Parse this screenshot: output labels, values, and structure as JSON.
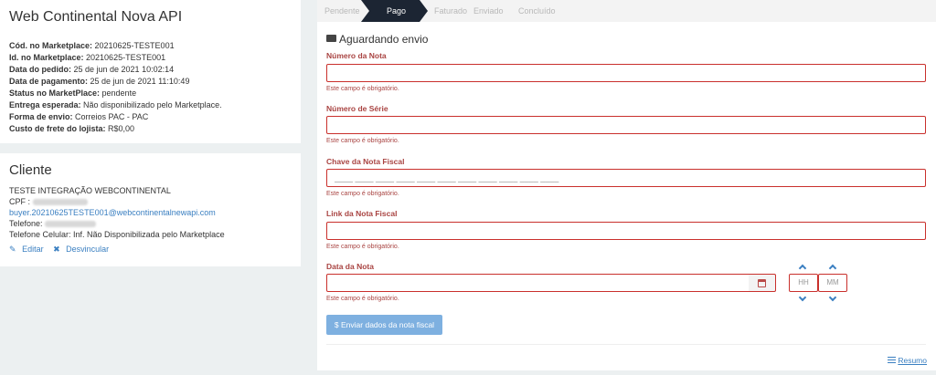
{
  "order": {
    "title": "Web Continental Nova API",
    "fields": [
      {
        "label": "Cód. no Marketplace:",
        "value": " 20210625-TESTE001"
      },
      {
        "label": "Id. no Marketplace:",
        "value": " 20210625-TESTE001"
      },
      {
        "label": "Data do pedido:",
        "value": " 25 de jun de 2021 10:02:14"
      },
      {
        "label": "Data de pagamento:",
        "value": " 25 de jun de 2021 11:10:49"
      },
      {
        "label": "Status no MarketPlace:",
        "value": " pendente"
      },
      {
        "label": "Entrega esperada:",
        "value": " Não disponibilizado pelo Marketplace."
      },
      {
        "label": "Forma de envio:",
        "value": " Correios PAC - PAC"
      },
      {
        "label": "Custo de frete do lojista:",
        "value": " R$0,00"
      }
    ]
  },
  "client": {
    "title": "Cliente",
    "name": "TESTE INTEGRAÇÃO WEBCONTINENTAL",
    "cpf_label": "CPF : ",
    "email": "buyer.20210625TESTE001@webcontinentalnewapi.com",
    "phone_label": "Telefone: ",
    "mobile": "Telefone Celular: Inf. Não Disponibilizada pelo Marketplace",
    "edit_label": "Editar",
    "unlink_label": "Desvincular"
  },
  "steps": [
    "Pendente",
    "Pago",
    "Faturado",
    "Enviado",
    "Concluído"
  ],
  "active_step": "Pago",
  "section_title": "Aguardando envio",
  "form": {
    "nota_label": "Número da Nota",
    "serie_label": "Número de Série",
    "chave_label": "Chave da Nota Fiscal",
    "chave_mask": "____ ____ ____ ____ ____ ____ ____ ____ ____ ____ ____",
    "link_label": "Link da Nota Fiscal",
    "data_label": "Data da Nota",
    "required_msg": "Este campo é obrigatório.",
    "hh_placeholder": "HH",
    "mm_placeholder": "MM",
    "submit_label": "$ Enviar dados da nota fiscal"
  },
  "resumo_label": "Resumo",
  "colors": {
    "error": "#a94442",
    "step_active": "#1c2533",
    "link": "#3a7fc1",
    "button": "#7eb0e0"
  }
}
